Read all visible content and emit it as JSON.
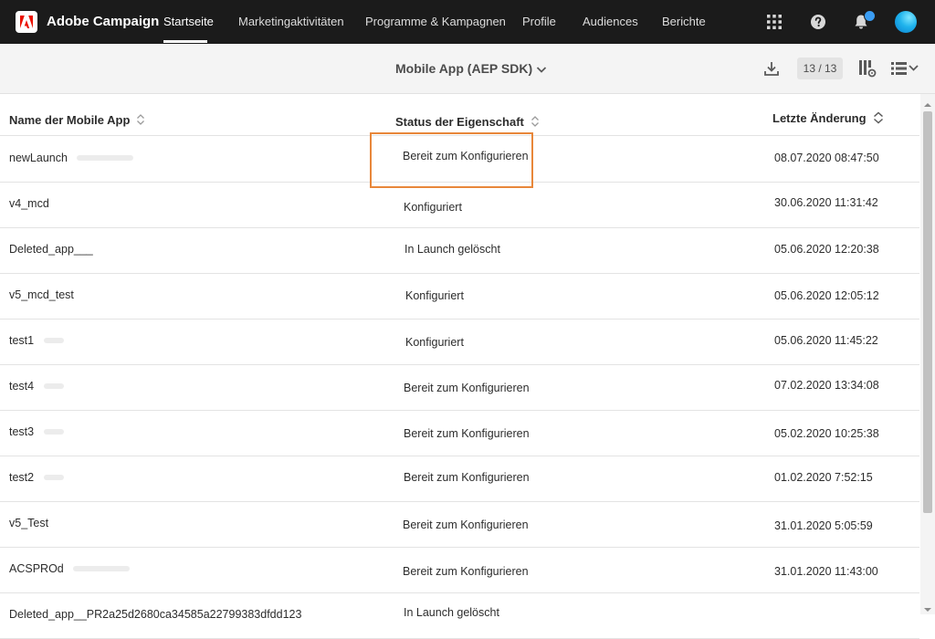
{
  "app": {
    "title": "Adobe Campaign"
  },
  "nav": {
    "items": [
      {
        "label": "Startseite"
      },
      {
        "label": "Marketingaktivitäten"
      },
      {
        "label": "Programme & Kampagnen"
      },
      {
        "label": "Profile"
      },
      {
        "label": "Audiences"
      },
      {
        "label": "Berichte"
      }
    ],
    "active": "Startseite",
    "icons": [
      "apps-grid-icon",
      "help-icon",
      "bell-icon",
      "avatar"
    ]
  },
  "toolbar": {
    "view_title": "Mobile App (AEP SDK)",
    "counter": "13 / 13",
    "icons": [
      "download-icon",
      "column-config-icon",
      "list-view-icon"
    ]
  },
  "table": {
    "columns": [
      {
        "label": "Name der Mobile App"
      },
      {
        "label": "Status der Eigenschaft"
      },
      {
        "label": "Letzte Änderung"
      }
    ],
    "rows": [
      {
        "name": "newLaunch",
        "status": "Bereit zum Konfigurieren",
        "date": "08.07.2020 08:47:50"
      },
      {
        "name": "v4_mcd",
        "status": "Konfiguriert",
        "date": "30.06.2020 11:31:42"
      },
      {
        "name": "Deleted_app___",
        "status": "In Launch gelöscht",
        "date": "05.06.2020 12:20:38"
      },
      {
        "name": "v5_mcd_test",
        "status": "Konfiguriert",
        "date": "05.06.2020 12:05:12"
      },
      {
        "name": "test1",
        "status": "Konfiguriert",
        "date": "05.06.2020 11:45:22"
      },
      {
        "name": "test4",
        "status": "Bereit zum Konfigurieren",
        "date": "07.02.2020 13:34:08"
      },
      {
        "name": "test3",
        "status": "Bereit zum Konfigurieren",
        "date": "05.02.2020 10:25:38"
      },
      {
        "name": "test2",
        "status": "Bereit zum Konfigurieren",
        "date": "01.02.2020 7:52:15"
      },
      {
        "name": "v5_Test",
        "status": "Bereit zum Konfigurieren",
        "date": "31.01.2020 5:05:59"
      },
      {
        "name": "ACSPROd",
        "status": "Bereit zum Konfigurieren",
        "date": "31.01.2020 11:43:00"
      },
      {
        "name": "Deleted_app__PR2a25d2680ca34585a22799383dfdd123",
        "status": "In Launch gelöscht",
        "date": ""
      }
    ]
  },
  "colors": {
    "nav_bg": "#1b1b1b",
    "toolbar_bg": "#f4f4f4",
    "highlight": "#e8873a",
    "notification": "#3a9df4"
  }
}
